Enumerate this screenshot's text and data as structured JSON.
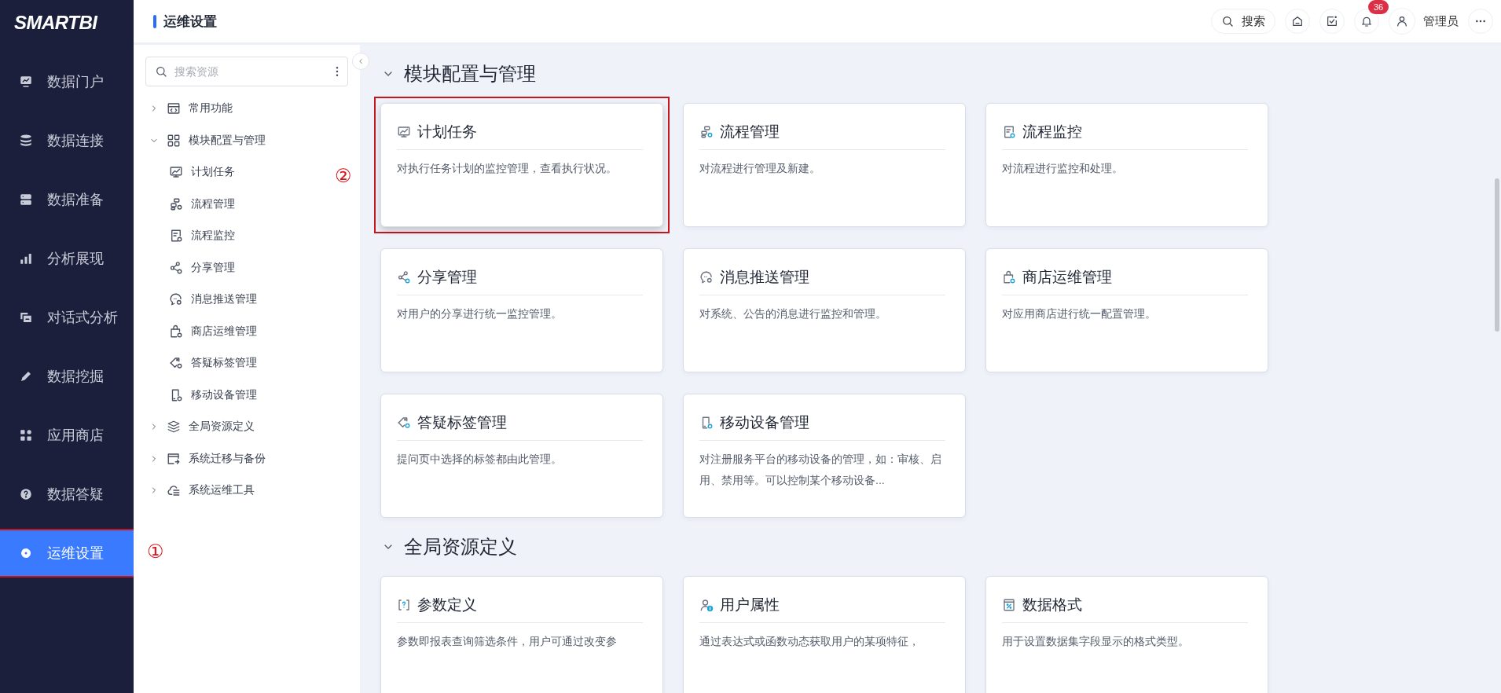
{
  "logo": "SMARTBI",
  "nav": {
    "items": [
      {
        "label": "数据门户",
        "selected": false
      },
      {
        "label": "数据连接",
        "selected": false
      },
      {
        "label": "数据准备",
        "selected": false
      },
      {
        "label": "分析展现",
        "selected": false
      },
      {
        "label": "对话式分析",
        "selected": false
      },
      {
        "label": "数据挖掘",
        "selected": false
      },
      {
        "label": "应用商店",
        "selected": false
      },
      {
        "label": "数据答疑",
        "selected": false
      },
      {
        "label": "运维设置",
        "selected": true,
        "highlighted": true
      }
    ]
  },
  "header": {
    "title": "运维设置",
    "search_label": "搜索",
    "notification_count": "36",
    "user": "管理员"
  },
  "tree": {
    "search": {
      "placeholder": "搜索资源"
    },
    "items": [
      {
        "label": "常用功能",
        "expanded": false
      },
      {
        "label": "模块配置与管理",
        "expanded": true,
        "children": [
          {
            "label": "计划任务"
          },
          {
            "label": "流程管理"
          },
          {
            "label": "流程监控"
          },
          {
            "label": "分享管理"
          },
          {
            "label": "消息推送管理"
          },
          {
            "label": "商店运维管理"
          },
          {
            "label": "答疑标签管理"
          },
          {
            "label": "移动设备管理"
          }
        ]
      },
      {
        "label": "全局资源定义",
        "expanded": false
      },
      {
        "label": "系统迁移与备份",
        "expanded": false
      },
      {
        "label": "系统运维工具",
        "expanded": false
      }
    ]
  },
  "sections": [
    {
      "title": "模块配置与管理",
      "expanded": true,
      "cards": [
        {
          "title": "计划任务",
          "description": "对执行任务计划的监控管理，查看执行状况。",
          "highlighted": true
        },
        {
          "title": "流程管理",
          "description": "对流程进行管理及新建。",
          "highlighted": false
        },
        {
          "title": "流程监控",
          "description": "对流程进行监控和处理。",
          "highlighted": false
        },
        {
          "title": "分享管理",
          "description": "对用户的分享进行统一监控管理。",
          "highlighted": false
        },
        {
          "title": "消息推送管理",
          "description": "对系统、公告的消息进行监控和管理。",
          "highlighted": false
        },
        {
          "title": "商店运维管理",
          "description": "对应用商店进行统一配置管理。",
          "highlighted": false
        },
        {
          "title": "答疑标签管理",
          "description": "提问页中选择的标签都由此管理。",
          "highlighted": false
        },
        {
          "title": "移动设备管理",
          "description": "对注册服务平台的移动设备的管理，如：审核、启用、禁用等。可以控制某个移动设备...",
          "highlighted": false
        }
      ]
    },
    {
      "title": "全局资源定义",
      "expanded": true,
      "cards": [
        {
          "title": "参数定义",
          "description": "参数即报表查询筛选条件，用户可通过改变参",
          "highlighted": false
        },
        {
          "title": "用户属性",
          "description": "通过表达式或函数动态获取用户的某项特征，",
          "highlighted": false
        },
        {
          "title": "数据格式",
          "description": "用于设置数据集字段显示的格式类型。",
          "highlighted": false
        }
      ]
    }
  ],
  "annotations": [
    {
      "label": "①"
    },
    {
      "label": "②"
    }
  ]
}
